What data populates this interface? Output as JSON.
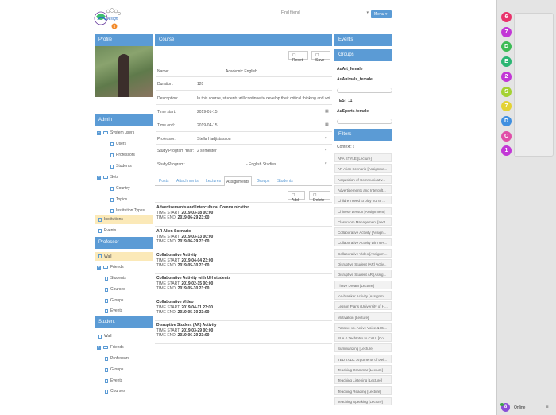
{
  "header": {
    "search_placeholder": "Find friend",
    "menu_label": "Menu"
  },
  "profile": {
    "title": "Profile"
  },
  "admin": {
    "title": "Admin",
    "items": [
      "System users",
      "Users",
      "Professors",
      "Students",
      "Sets",
      "Country",
      "Topics",
      "Institution Types",
      "Institutions",
      "Events"
    ]
  },
  "professor": {
    "title": "Professor",
    "items": [
      "Wall",
      "Friends",
      "Students",
      "Courses",
      "Groups",
      "Events"
    ]
  },
  "student": {
    "title": "Student",
    "items": [
      "Wall",
      "Friends",
      "Professors",
      "Groups",
      "Events",
      "Courses"
    ]
  },
  "course": {
    "title": "Course",
    "reset_label": "Reset",
    "save_label": "Save",
    "fields": [
      {
        "label": "Name:",
        "value": "Academic English"
      },
      {
        "label": "Duration:",
        "value": "120"
      },
      {
        "label": "Description:",
        "value": "In this course, students will continue to develop their critical thinking and writi"
      },
      {
        "label": "Time start:",
        "value": "2019-01-15"
      },
      {
        "label": "Time end:",
        "value": "2019-04-15"
      },
      {
        "label": "Professor:",
        "value": "Stella Hadjistassou"
      },
      {
        "label": "Study Program Year:",
        "value": "2 semester"
      },
      {
        "label": "Study Program:",
        "value": "- English Studies"
      }
    ],
    "tabs": [
      "Posts",
      "Attachments",
      "Lectures",
      "Assignments",
      "Groups",
      "Students"
    ],
    "add_label": "Add",
    "delete_label": "Delete",
    "time_start_label": "TIME START:",
    "time_end_label": "TIME END:",
    "assignments": [
      {
        "title": "Advertisements and Intercultural Communication",
        "start": "2019-03-18 00:00",
        "end": "2019-06-29 23:00"
      },
      {
        "title": "AR Alien Scenario",
        "start": "2019-03-13 00:00",
        "end": "2019-06-29 23:00"
      },
      {
        "title": "Collaborative Activity",
        "start": "2019-04-04 23:00",
        "end": "2019-05-30 23:00"
      },
      {
        "title": "Collaborative Activity with UH students",
        "start": "2019-02-15 00:00",
        "end": "2019-05-30 23:00"
      },
      {
        "title": "Collaborative Video",
        "start": "2019-04-11 23:00",
        "end": "2019-05-30 23:00"
      },
      {
        "title": "Disruptive Student (AR) Activity",
        "start": "2019-03-29 00:00",
        "end": "2019-06-29 23:00"
      }
    ]
  },
  "events": {
    "title": "Events"
  },
  "groups": {
    "title": "Groups",
    "items": [
      "AuArt_female",
      "AuAnimals_female",
      "TEST 11",
      "AuSports-female"
    ]
  },
  "filters": {
    "title": "Filters",
    "context_label": "Context:",
    "items": [
      "APA STYLE [Lecture]",
      "AR Alien Scenario [Assignme...",
      "Acquisition of Communicativ...",
      "Advertisements and Intercult...",
      "Children need to play not to ...",
      "Chinese Lesson [Assignment]",
      "Classroom Management [Lect...",
      "Collaborative Activity [Assign...",
      "Collaborative Activity with UH...",
      "Collaborative Video [Assignm...",
      "Disruptive Student (AR) Activ...",
      "Disruptive Student AR [Assig...",
      "I have Dream [Lecture]",
      "Ice-breaker Activity [Assignm...",
      "Lesson Plans (University of H...",
      "Motivation [Lecture]",
      "Passive vs. Active Voice & Or...",
      "SLA & TechIntro to CALL [Co...",
      "Summarizing [Lecture]",
      "TED TALK: Arguments of Def...",
      "Teaching Grammar [Lecture]",
      "Teaching Listening [Lecture]",
      "Teaching Reading [Lecture]",
      "Teaching Speaking [Lecture]"
    ]
  },
  "chat": {
    "bubbles": [
      {
        "n": "6",
        "color": "#e8336b"
      },
      {
        "n": "7",
        "color": "#c237d6"
      },
      {
        "n": "D",
        "color": "#3dbb55"
      },
      {
        "n": "E",
        "color": "#2bb673"
      },
      {
        "n": "2",
        "color": "#c237d6"
      },
      {
        "n": "S",
        "color": "#a4d233"
      },
      {
        "n": "7",
        "color": "#e3d234"
      },
      {
        "n": "D",
        "color": "#3f8fe0"
      },
      {
        "n": "C",
        "color": "#e04fa8"
      },
      {
        "n": "1",
        "color": "#c237d6"
      }
    ],
    "online_count": "8",
    "online_label": "Online"
  }
}
